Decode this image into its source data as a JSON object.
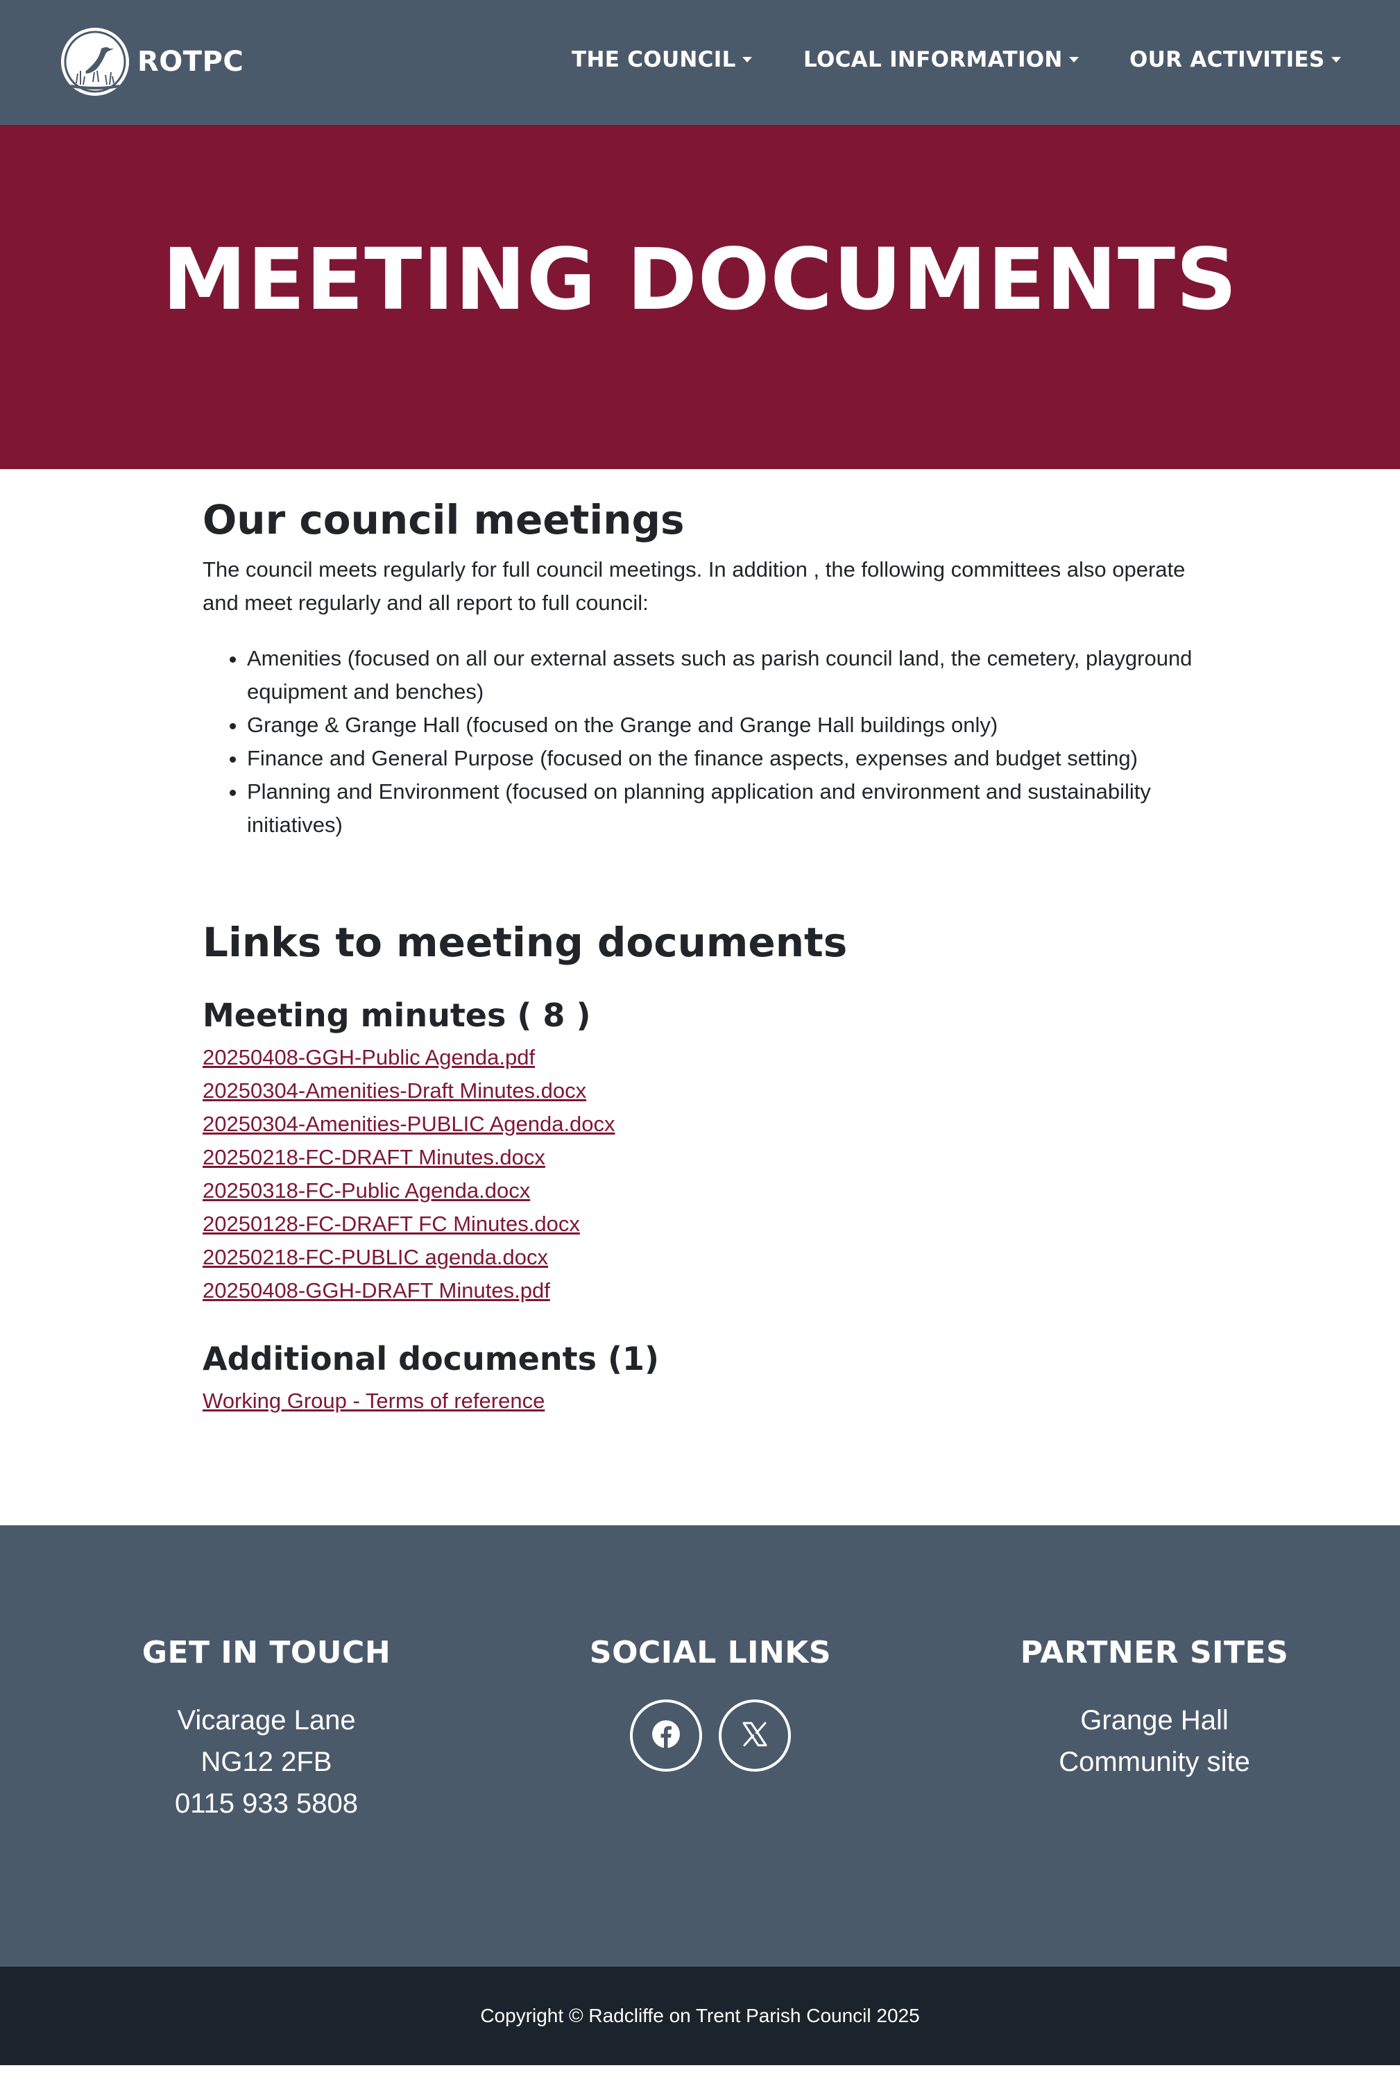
{
  "nav": {
    "brand": "ROTPC",
    "logo_icon": "heron-icon",
    "items": [
      {
        "label": "THE COUNCIL"
      },
      {
        "label": "LOCAL INFORMATION"
      },
      {
        "label": "OUR ACTIVITIES"
      }
    ]
  },
  "hero": {
    "title": "MEETING DOCUMENTS"
  },
  "intro": {
    "heading": "Our council meetings",
    "paragraph": "The council meets regularly for full council meetings. In addition , the following committees also operate and meet regularly and all report to full council:",
    "committees": [
      "Amenities (focused on all our external assets such as parish council land, the cemetery, playground equipment and benches)",
      "Grange & Grange Hall (focused on the Grange and Grange Hall buildings only)",
      "Finance and General Purpose (focused on the finance aspects, expenses and budget setting)",
      "Planning and Environment (focused on planning application and environment and sustainability initiatives)"
    ]
  },
  "links": {
    "heading": "Links to meeting documents",
    "minutes_heading": "Meeting minutes ( 8 )",
    "minutes": [
      "20250408-GGH-Public Agenda.pdf",
      "20250304-Amenities-Draft Minutes.docx",
      "20250304-Amenities-PUBLIC Agenda.docx",
      "20250218-FC-DRAFT Minutes.docx",
      "20250318-FC-Public Agenda.docx",
      "20250128-FC-DRAFT FC Minutes.docx",
      "20250218-FC-PUBLIC agenda.docx",
      "20250408-GGH-DRAFT Minutes.pdf"
    ],
    "additional_heading": "Additional documents (1)",
    "additional": [
      "Working Group - Terms of reference"
    ]
  },
  "footer": {
    "contact": {
      "heading": "GET IN TOUCH",
      "lines": [
        "Vicarage Lane",
        "NG12 2FB",
        "0115 933 5808"
      ]
    },
    "social": {
      "heading": "SOCIAL LINKS",
      "icons": [
        "facebook-icon",
        "x-icon"
      ]
    },
    "partners": {
      "heading": "PARTNER SITES",
      "links": [
        "Grange Hall",
        "Community site"
      ]
    },
    "copyright": "Copyright © Radcliffe on Trent Parish Council 2025"
  },
  "colors": {
    "nav_bg": "#4b5a6a",
    "hero_bg": "#7f1734",
    "link": "#7f1734",
    "copyright_bg": "#1c232c"
  }
}
